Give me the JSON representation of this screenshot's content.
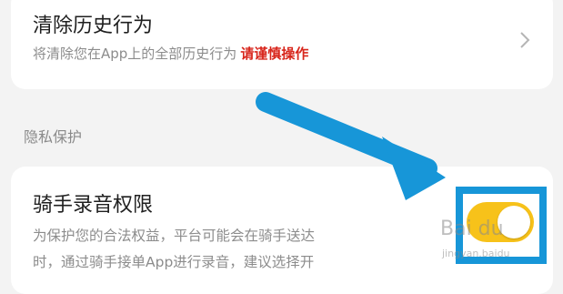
{
  "history": {
    "title": "清除历史行为",
    "subtitle": "将清除您在App上的全部历史行为",
    "warning": "请谨慎操作"
  },
  "privacy_section": {
    "label": "隐私保护"
  },
  "rider_recording": {
    "title": "骑手录音权限",
    "description_line1": "为保护您的合法权益，平台可能会在骑手送达",
    "description_line2": "时，通过骑手接单App进行录音，建议选择开"
  },
  "toggle": {
    "state": "on"
  },
  "colors": {
    "accent_yellow": "#f7c21a",
    "warning_red": "#d8261c",
    "annotation_blue": "#1796d8"
  },
  "watermark": {
    "brand": "Bai du",
    "sub": "jingyan.baidu"
  }
}
